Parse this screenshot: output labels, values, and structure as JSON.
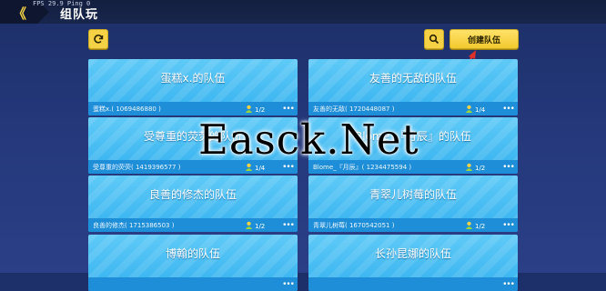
{
  "header": {
    "fps_text": "FPS 29.9  Ping 0",
    "title": "组队玩",
    "back_glyph": "《"
  },
  "toolbar": {
    "create_label": "创建队伍"
  },
  "watermark": "Easck.Net",
  "teams": [
    {
      "title": "蛋糕x.的队伍",
      "leader": "蛋糕x.( 1069486880 )",
      "count": "1/2"
    },
    {
      "title": "友善的无敌的队伍",
      "leader": "友善的无敌( 1720448087 )",
      "count": "1/4"
    },
    {
      "title": "受尊重的荧荧的队伍",
      "leader": "受尊重的荧荧( 1419396577 )",
      "count": "1/4"
    },
    {
      "title": "Blome_『月辰』的队伍",
      "leader": "Blome_『月辰』( 1234475594 )",
      "count": "1/2"
    },
    {
      "title": "良善的修杰的队伍",
      "leader": "良善的修杰( 1715386503 )",
      "count": "1/2"
    },
    {
      "title": "青翠儿树莓的队伍",
      "leader": "青翠儿树莓( 1670542051 )",
      "count": "1/2"
    },
    {
      "title": "博翰的队伍",
      "leader": "",
      "count": ""
    },
    {
      "title": "长孙昆娜的队伍",
      "leader": "",
      "count": ""
    }
  ],
  "more_glyph": "•••",
  "colors": {
    "accent_yellow": "#f5d245",
    "card_blue": "#34b1ef",
    "footer_blue": "#1f8ed8"
  }
}
